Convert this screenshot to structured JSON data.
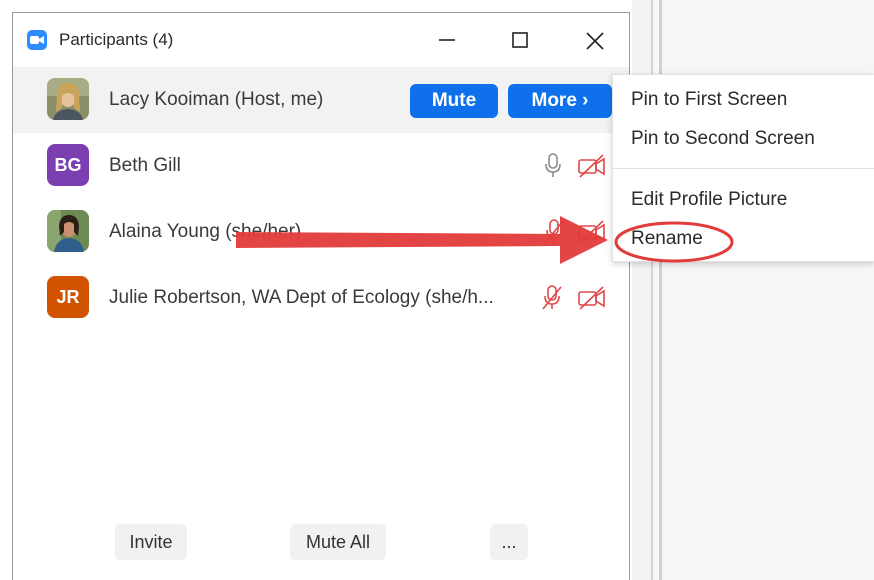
{
  "window": {
    "title": "Participants (4)"
  },
  "participants": [
    {
      "name": "Lacy Kooiman (Host, me)",
      "initials": "",
      "avatar_type": "photo",
      "mute_label": "Mute",
      "more_label": "More ›"
    },
    {
      "name": "Beth Gill",
      "initials": "BG",
      "avatar_color": "#7B3FB2",
      "mic": "mic-icon",
      "video": "video-off-icon"
    },
    {
      "name": "Alaina Young (she/her)",
      "initials": "",
      "avatar_type": "photo",
      "mic": "mic-off-icon",
      "video": "video-off-icon"
    },
    {
      "name": "Julie Robertson, WA Dept of Ecology (she/h...",
      "initials": "JR",
      "avatar_color": "#D35400",
      "mic": "mic-off-icon",
      "video": "video-off-icon"
    }
  ],
  "footer": {
    "invite": "Invite",
    "mute_all": "Mute All",
    "more": "..."
  },
  "menu": {
    "items": [
      "Pin to First Screen",
      "Pin to Second Screen",
      "Edit Profile Picture",
      "Rename"
    ],
    "highlighted": "Rename"
  },
  "colors": {
    "accent": "#0E71EB",
    "annotation": "#E23B3B",
    "muted_icon": "#E04848"
  }
}
